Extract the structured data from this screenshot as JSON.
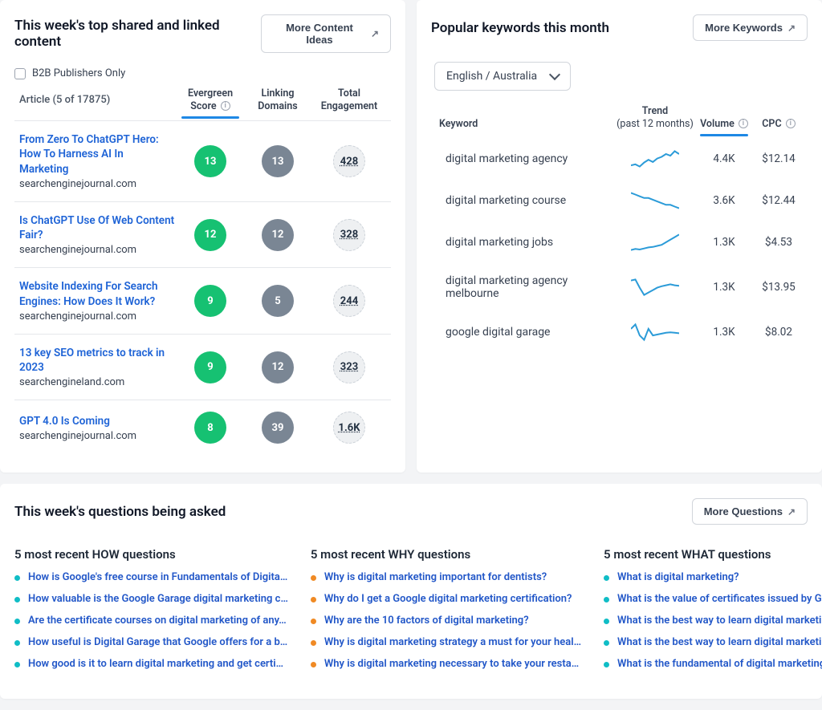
{
  "content_panel": {
    "title": "This week's top shared and linked content",
    "more_btn": "More Content Ideas",
    "b2b_label": "B2B Publishers Only",
    "article_count_label": "Article (5 of 17875)",
    "cols": {
      "evergreen": "Evergreen Score",
      "linking": "Linking Domains",
      "engagement": "Total Engagement"
    },
    "rows": [
      {
        "title": "From Zero To ChatGPT Hero: How To Harness AI In Marketing",
        "domain": "searchenginejournal.com",
        "evergreen": "13",
        "linking": "13",
        "engagement": "428"
      },
      {
        "title": "Is ChatGPT Use Of Web Content Fair?",
        "domain": "searchenginejournal.com",
        "evergreen": "12",
        "linking": "12",
        "engagement": "328"
      },
      {
        "title": "Website Indexing For Search Engines: How Does It Work?",
        "domain": "searchenginejournal.com",
        "evergreen": "9",
        "linking": "5",
        "engagement": "244"
      },
      {
        "title": "13 key SEO metrics to track in 2023",
        "domain": "searchengineland.com",
        "evergreen": "9",
        "linking": "12",
        "engagement": "323"
      },
      {
        "title": "GPT 4.0 Is Coming",
        "domain": "searchenginejournal.com",
        "evergreen": "8",
        "linking": "39",
        "engagement": "1.6K"
      }
    ]
  },
  "keyword_panel": {
    "title": "Popular keywords this month",
    "more_btn": "More Keywords",
    "lang_label": "English / Australia",
    "cols": {
      "keyword": "Keyword",
      "trend": "Trend",
      "trend_sub": "(past 12 months)",
      "volume": "Volume",
      "cpc": "CPC"
    },
    "rows": [
      {
        "name": "digital marketing agency",
        "volume": "4.4K",
        "cpc": "$12.14",
        "trend": [
          40,
          42,
          38,
          45,
          50,
          46,
          52,
          55,
          60,
          57,
          65,
          60
        ]
      },
      {
        "name": "digital marketing course",
        "volume": "3.6K",
        "cpc": "$12.44",
        "trend": [
          45,
          44,
          43,
          42,
          42,
          41,
          40,
          39,
          38,
          38,
          37,
          36
        ]
      },
      {
        "name": "digital marketing jobs",
        "volume": "1.3K",
        "cpc": "$4.53",
        "trend": [
          30,
          32,
          31,
          33,
          35,
          36,
          38,
          40,
          45,
          50,
          55,
          60
        ]
      },
      {
        "name": "digital marketing agency melbourne",
        "volume": "1.3K",
        "cpc": "$13.95",
        "trend": [
          60,
          62,
          45,
          30,
          35,
          40,
          45,
          48,
          50,
          52,
          50,
          49
        ]
      },
      {
        "name": "google digital garage",
        "volume": "1.3K",
        "cpc": "$8.02",
        "trend": [
          55,
          65,
          40,
          30,
          55,
          40,
          42,
          44,
          46,
          47,
          46,
          45
        ]
      }
    ]
  },
  "questions_panel": {
    "title": "This week's questions being asked",
    "more_btn": "More Questions",
    "columns": [
      {
        "title": "5 most recent HOW questions",
        "dot": "cyan",
        "items": [
          "How is Google's free course in Fundamentals of Digita…",
          "How valuable is the Google Garage digital marketing c…",
          "Are the certificate courses on digital marketing of any…",
          "How useful is Digital Garage that Google offers for a b…",
          "How good is it to learn digital marketing and get certi…"
        ]
      },
      {
        "title": "5 most recent WHY questions",
        "dot": "orange",
        "items": [
          "Why is digital marketing important for dentists?",
          "Why do I get a Google digital marketing certification?",
          "Why are the 10 factors of digital marketing?",
          "Why is digital marketing strategy a must for your heal…",
          "Why is digital marketing necessary to take your resta…"
        ]
      },
      {
        "title": "5 most recent WHAT questions",
        "dot": "cyan",
        "items": [
          "What is digital marketing?",
          "What is the value of certificates issued by Google for …",
          "What is the best way to learn digital marketing funda…",
          "What is the best way to learn digital marketing?",
          "What is the fundamental of digital marketing, and how…"
        ]
      }
    ]
  }
}
